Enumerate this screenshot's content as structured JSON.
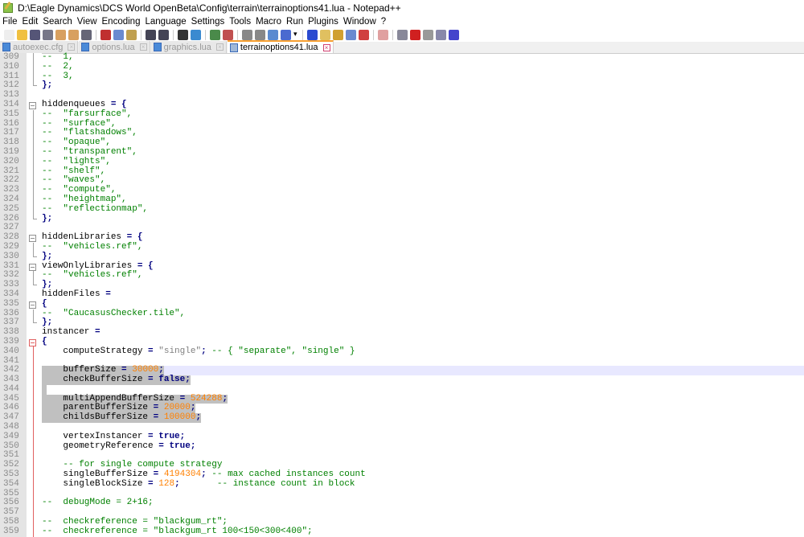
{
  "window": {
    "title": "D:\\Eagle Dynamics\\DCS World OpenBeta\\Config\\terrain\\terrainoptions41.lua - Notepad++"
  },
  "menu": [
    "File",
    "Edit",
    "Search",
    "View",
    "Encoding",
    "Language",
    "Settings",
    "Tools",
    "Macro",
    "Run",
    "Plugins",
    "Window",
    "?"
  ],
  "toolbar_icons": [
    "new-file",
    "open-file",
    "save",
    "save-all",
    "close",
    "close-all",
    "print",
    "cut",
    "copy",
    "paste",
    "undo",
    "redo",
    "find",
    "replace",
    "zoom-in",
    "zoom-out",
    "sync-v",
    "sync-h",
    "word-wrap",
    "show-all-chars",
    "dropdown",
    "indent-guide",
    "udl",
    "doc-map",
    "function-list",
    "folder-workspace",
    "monitor",
    "record-macro",
    "stop-macro",
    "play-macro",
    "run-macro-multiple",
    "save-macro"
  ],
  "tabs": [
    {
      "label": "autoexec.cfg",
      "active": false
    },
    {
      "label": "options.lua",
      "active": false
    },
    {
      "label": "graphics.lua",
      "active": false
    },
    {
      "label": "terrainoptions41.lua",
      "active": true
    }
  ],
  "editor": {
    "lines": [
      {
        "n": "309",
        "fold": "v",
        "seg": [
          [
            "c",
            "--  1,"
          ]
        ]
      },
      {
        "n": "310",
        "fold": "v",
        "seg": [
          [
            "c",
            "--  2,"
          ]
        ]
      },
      {
        "n": "311",
        "fold": "v",
        "seg": [
          [
            "c",
            "--  3,"
          ]
        ]
      },
      {
        "n": "312",
        "fold": "end",
        "seg": [
          [
            "o",
            "};"
          ]
        ]
      },
      {
        "n": "313",
        "fold": "",
        "seg": []
      },
      {
        "n": "314",
        "fold": "box",
        "seg": [
          [
            "t",
            "hiddenqueues "
          ],
          [
            "o",
            "="
          ],
          [
            "t",
            " "
          ],
          [
            "o",
            "{"
          ]
        ]
      },
      {
        "n": "315",
        "fold": "v",
        "seg": [
          [
            "c",
            "--  \"farsurface\","
          ]
        ]
      },
      {
        "n": "316",
        "fold": "v",
        "seg": [
          [
            "c",
            "--  \"surface\","
          ]
        ]
      },
      {
        "n": "317",
        "fold": "v",
        "seg": [
          [
            "c",
            "--  \"flatshadows\","
          ]
        ]
      },
      {
        "n": "318",
        "fold": "v",
        "seg": [
          [
            "c",
            "--  \"opaque\","
          ]
        ]
      },
      {
        "n": "319",
        "fold": "v",
        "seg": [
          [
            "c",
            "--  \"transparent\","
          ]
        ]
      },
      {
        "n": "320",
        "fold": "v",
        "seg": [
          [
            "c",
            "--  \"lights\","
          ]
        ]
      },
      {
        "n": "321",
        "fold": "v",
        "seg": [
          [
            "c",
            "--  \"shelf\","
          ]
        ]
      },
      {
        "n": "322",
        "fold": "v",
        "seg": [
          [
            "c",
            "--  \"waves\","
          ]
        ]
      },
      {
        "n": "323",
        "fold": "v",
        "seg": [
          [
            "c",
            "--  \"compute\","
          ]
        ]
      },
      {
        "n": "324",
        "fold": "v",
        "seg": [
          [
            "c",
            "--  \"heightmap\","
          ]
        ]
      },
      {
        "n": "325",
        "fold": "v",
        "seg": [
          [
            "c",
            "--  \"reflectionmap\","
          ]
        ]
      },
      {
        "n": "326",
        "fold": "end",
        "seg": [
          [
            "o",
            "};"
          ]
        ]
      },
      {
        "n": "327",
        "fold": "",
        "seg": []
      },
      {
        "n": "328",
        "fold": "box",
        "seg": [
          [
            "t",
            "hiddenLibraries "
          ],
          [
            "o",
            "="
          ],
          [
            "t",
            " "
          ],
          [
            "o",
            "{"
          ]
        ]
      },
      {
        "n": "329",
        "fold": "v",
        "seg": [
          [
            "c",
            "--  \"vehicles.ref\","
          ]
        ]
      },
      {
        "n": "330",
        "fold": "end",
        "seg": [
          [
            "o",
            "};"
          ]
        ]
      },
      {
        "n": "331",
        "fold": "box",
        "seg": [
          [
            "t",
            "viewOnlyLibraries "
          ],
          [
            "o",
            "="
          ],
          [
            "t",
            " "
          ],
          [
            "o",
            "{"
          ]
        ]
      },
      {
        "n": "332",
        "fold": "v",
        "seg": [
          [
            "c",
            "--  \"vehicles.ref\","
          ]
        ]
      },
      {
        "n": "333",
        "fold": "end",
        "seg": [
          [
            "o",
            "};"
          ]
        ]
      },
      {
        "n": "334",
        "fold": "",
        "seg": [
          [
            "t",
            "hiddenFiles "
          ],
          [
            "o",
            "="
          ]
        ]
      },
      {
        "n": "335",
        "fold": "box",
        "seg": [
          [
            "o",
            "{"
          ]
        ]
      },
      {
        "n": "336",
        "fold": "v",
        "seg": [
          [
            "c",
            "--  \"CaucasusChecker.tile\","
          ]
        ]
      },
      {
        "n": "337",
        "fold": "end",
        "seg": [
          [
            "o",
            "};"
          ]
        ]
      },
      {
        "n": "338",
        "fold": "",
        "seg": [
          [
            "t",
            "instancer "
          ],
          [
            "o",
            "="
          ]
        ]
      },
      {
        "n": "339",
        "fold": "boxred",
        "seg": [
          [
            "o",
            "{"
          ]
        ]
      },
      {
        "n": "340",
        "fold": "red",
        "seg": [
          [
            "t",
            "    computeStrategy "
          ],
          [
            "o",
            "="
          ],
          [
            "t",
            " "
          ],
          [
            "s",
            "\"single\""
          ],
          [
            "o",
            ";"
          ],
          [
            "t",
            " "
          ],
          [
            "c",
            "-- { \"separate\", \"single\" }"
          ]
        ]
      },
      {
        "n": "341",
        "fold": "red",
        "seg": []
      },
      {
        "n": "342",
        "fold": "red",
        "cur": true,
        "sel": true,
        "seg": [
          [
            "t",
            "    bufferSize "
          ],
          [
            "o",
            "="
          ],
          [
            "t",
            " "
          ],
          [
            "n",
            "30000"
          ],
          [
            "o",
            ";"
          ]
        ]
      },
      {
        "n": "343",
        "fold": "red",
        "sel": true,
        "seg": [
          [
            "t",
            "    checkBufferSize "
          ],
          [
            "o",
            "="
          ],
          [
            "t",
            " "
          ],
          [
            "k",
            "false"
          ],
          [
            "o",
            ";"
          ]
        ]
      },
      {
        "n": "344",
        "fold": "red",
        "sel": true,
        "seg": []
      },
      {
        "n": "345",
        "fold": "red",
        "sel": true,
        "seg": [
          [
            "t",
            "    multiAppendBufferSize "
          ],
          [
            "o",
            "="
          ],
          [
            "t",
            " "
          ],
          [
            "n",
            "524288"
          ],
          [
            "o",
            ";"
          ]
        ]
      },
      {
        "n": "346",
        "fold": "red",
        "sel": true,
        "seg": [
          [
            "t",
            "    parentBufferSize "
          ],
          [
            "o",
            "="
          ],
          [
            "t",
            " "
          ],
          [
            "n",
            "20000"
          ],
          [
            "o",
            ";"
          ]
        ]
      },
      {
        "n": "347",
        "fold": "red",
        "sel": true,
        "seg": [
          [
            "t",
            "    childsBufferSize "
          ],
          [
            "o",
            "="
          ],
          [
            "t",
            " "
          ],
          [
            "n",
            "100000"
          ],
          [
            "o",
            ";"
          ]
        ]
      },
      {
        "n": "348",
        "fold": "red",
        "seg": []
      },
      {
        "n": "349",
        "fold": "red",
        "seg": [
          [
            "t",
            "    vertexInstancer "
          ],
          [
            "o",
            "="
          ],
          [
            "t",
            " "
          ],
          [
            "k",
            "true"
          ],
          [
            "o",
            ";"
          ]
        ]
      },
      {
        "n": "350",
        "fold": "red",
        "seg": [
          [
            "t",
            "    geometryReference "
          ],
          [
            "o",
            "="
          ],
          [
            "t",
            " "
          ],
          [
            "k",
            "true"
          ],
          [
            "o",
            ";"
          ]
        ]
      },
      {
        "n": "351",
        "fold": "red",
        "seg": []
      },
      {
        "n": "352",
        "fold": "red",
        "seg": [
          [
            "t",
            "    "
          ],
          [
            "c",
            "-- for single compute strategy"
          ]
        ]
      },
      {
        "n": "353",
        "fold": "red",
        "seg": [
          [
            "t",
            "    singleBufferSize "
          ],
          [
            "o",
            "="
          ],
          [
            "t",
            " "
          ],
          [
            "n",
            "4194304"
          ],
          [
            "o",
            ";"
          ],
          [
            "t",
            " "
          ],
          [
            "c",
            "-- max cached instances count"
          ]
        ]
      },
      {
        "n": "354",
        "fold": "red",
        "seg": [
          [
            "t",
            "    singleBlockSize "
          ],
          [
            "o",
            "="
          ],
          [
            "t",
            " "
          ],
          [
            "n",
            "128"
          ],
          [
            "o",
            ";"
          ],
          [
            "t",
            "       "
          ],
          [
            "c",
            "-- instance count in block"
          ]
        ]
      },
      {
        "n": "355",
        "fold": "red",
        "seg": []
      },
      {
        "n": "356",
        "fold": "red",
        "seg": [
          [
            "c",
            "--  debugMode = 2+16;"
          ]
        ]
      },
      {
        "n": "357",
        "fold": "red",
        "seg": []
      },
      {
        "n": "358",
        "fold": "red",
        "seg": [
          [
            "c",
            "--  checkreference = \"blackgum_rt\";"
          ]
        ]
      },
      {
        "n": "359",
        "fold": "red",
        "seg": [
          [
            "c",
            "--  checkreference = \"blackgum_rt 100<150<300<400\";"
          ]
        ]
      }
    ]
  }
}
